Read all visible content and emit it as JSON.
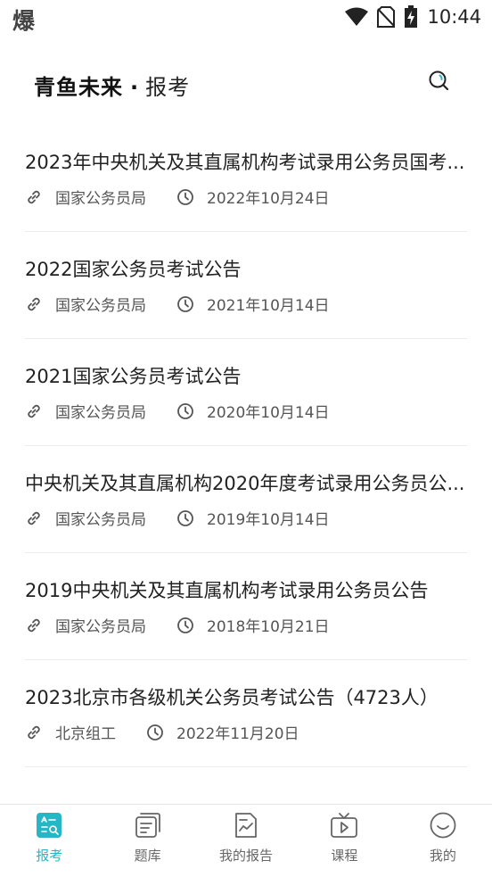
{
  "status_bar": {
    "left_glyph": "爆",
    "time": "10:44"
  },
  "header": {
    "brand": "青鱼未来",
    "separator": "·",
    "section": "报考",
    "search_icon": "search-icon"
  },
  "announcements": [
    {
      "title": "2023年中央机关及其直属机构考试录用公务员国考...",
      "source": "国家公务员局",
      "date": "2022年10月24日"
    },
    {
      "title": "2022国家公务员考试公告",
      "source": "国家公务员局",
      "date": "2021年10月14日"
    },
    {
      "title": "2021国家公务员考试公告",
      "source": "国家公务员局",
      "date": "2020年10月14日"
    },
    {
      "title": "中央机关及其直属机构2020年度考试录用公务员公...",
      "source": "国家公务员局",
      "date": "2019年10月14日"
    },
    {
      "title": "2019中央机关及其直属机构考试录用公务员公告",
      "source": "国家公务员局",
      "date": "2018年10月21日"
    },
    {
      "title": "2023北京市各级机关公务员考试公告（4723人）",
      "source": "北京组工",
      "date": "2022年11月20日"
    }
  ],
  "bottom_nav": {
    "items": [
      {
        "label": "报考",
        "icon": "exam-register-icon",
        "active": true
      },
      {
        "label": "题库",
        "icon": "question-bank-icon",
        "active": false
      },
      {
        "label": "我的报告",
        "icon": "report-icon",
        "active": false
      },
      {
        "label": "课程",
        "icon": "course-tv-icon",
        "active": false
      },
      {
        "label": "我的",
        "icon": "profile-smile-icon",
        "active": false
      }
    ]
  },
  "colors": {
    "accent": "#26b6c6",
    "text_primary": "#222222",
    "text_secondary": "#555555",
    "divider": "#ececec"
  }
}
